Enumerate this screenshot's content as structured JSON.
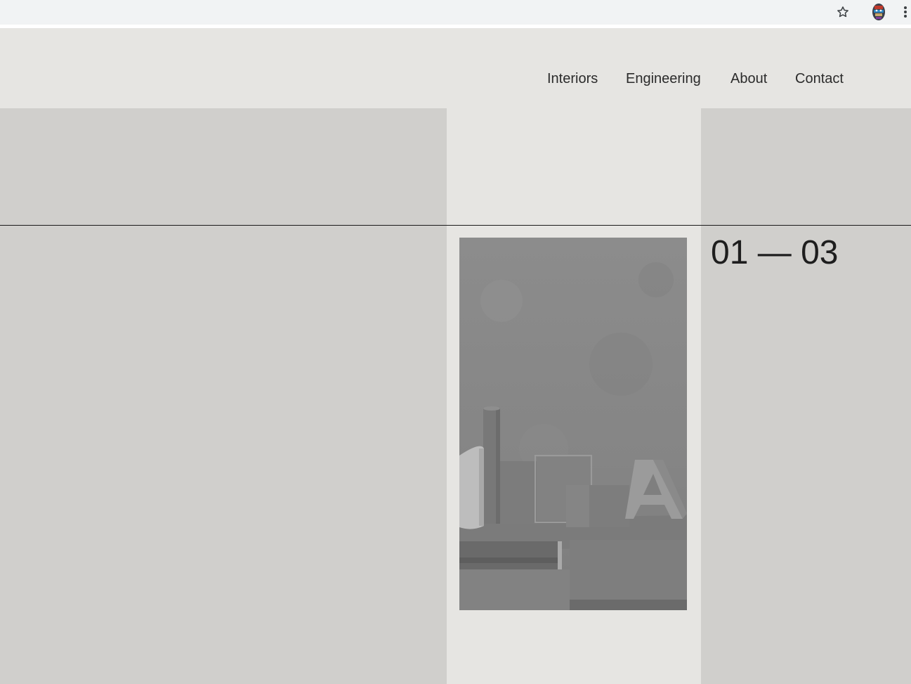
{
  "browser": {
    "star_icon": "star-outline-icon",
    "avatar_icon": "profile-avatar-icon",
    "menu_icon": "more-vert-icon"
  },
  "nav": {
    "items": [
      {
        "label": "Interiors"
      },
      {
        "label": "Engineering"
      },
      {
        "label": "About"
      },
      {
        "label": "Contact"
      }
    ]
  },
  "slider": {
    "counter": "01 — 03"
  },
  "colors": {
    "header_bg": "#e6e5e2",
    "panel_bg": "#d0cfcc",
    "text": "#2b2b2b",
    "divider": "#1a1a1a"
  }
}
